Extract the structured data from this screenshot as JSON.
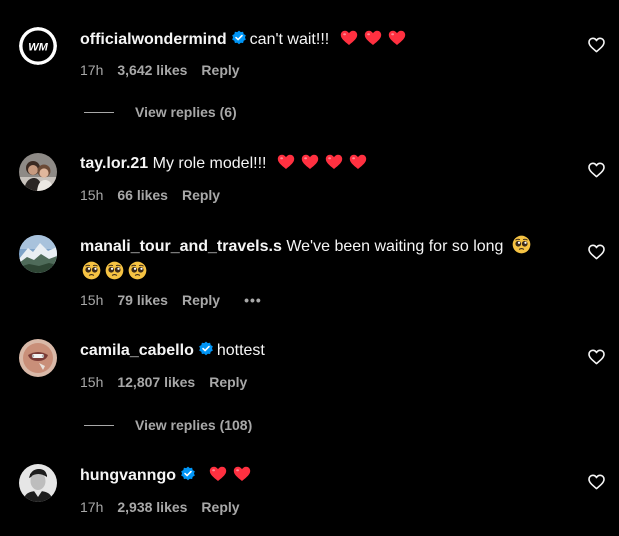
{
  "comments": [
    {
      "username": "officialwondermind",
      "verified": true,
      "text": "can't wait!!!",
      "hearts": 3,
      "time": "17h",
      "likes": "3,642 likes",
      "reply": "Reply",
      "view_replies": "View replies (6)",
      "avatar_icon": "wondermind-logo-icon",
      "avatar_letters": "WM"
    },
    {
      "username": "tay.lor.21",
      "verified": false,
      "text": "My role model!!!",
      "hearts": 4,
      "time": "15h",
      "likes": "66 likes",
      "reply": "Reply",
      "avatar_icon": "profile-photo"
    },
    {
      "username": "manali_tour_and_travels.s",
      "verified": false,
      "text": "We've been waiting for so long",
      "emoji": "pleading-face-emoji",
      "emoji_count": 4,
      "time": "15h",
      "likes": "79 likes",
      "reply": "Reply",
      "more": "•••",
      "avatar_icon": "mountain-photo"
    },
    {
      "username": "camila_cabello",
      "verified": true,
      "text": "hottest",
      "time": "15h",
      "likes": "12,807 likes",
      "reply": "Reply",
      "view_replies": "View replies (108)",
      "avatar_icon": "profile-photo"
    },
    {
      "username": "hungvanngo",
      "verified": true,
      "text": "",
      "hearts": 2,
      "time": "17h",
      "likes": "2,938 likes",
      "reply": "Reply",
      "avatar_icon": "profile-photo"
    }
  ],
  "colors": {
    "background": "#000000",
    "text": "#f5f5f5",
    "muted": "#a8a8a8",
    "verified": "#0095f6",
    "heart": "#ff3040"
  }
}
